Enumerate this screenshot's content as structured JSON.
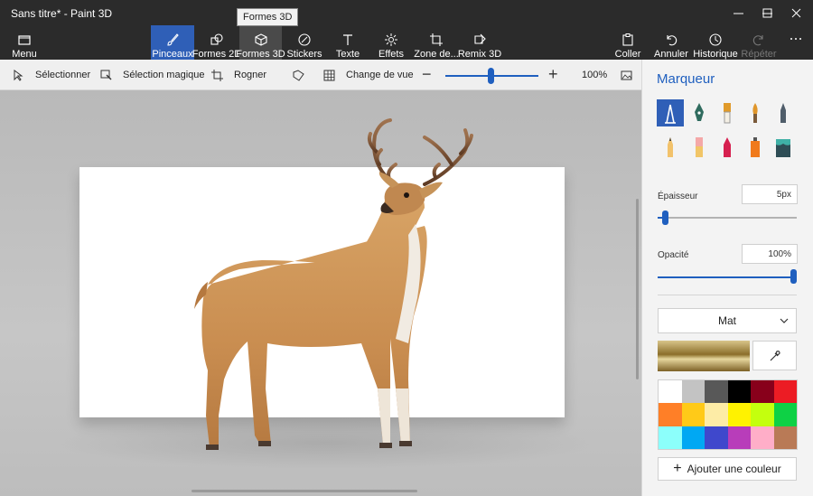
{
  "window": {
    "title": "Sans titre* - Paint 3D"
  },
  "ribbon": {
    "menu": "Menu",
    "brushes": "Pinceaux",
    "shapes2d": "Formes 2D",
    "shapes3d": "Formes 3D",
    "stickers": "Stickers",
    "text": "Texte",
    "effects": "Effets",
    "canvas": "Zone de...",
    "remix": "Remix 3D",
    "paste": "Coller",
    "undo": "Annuler",
    "history": "Historique",
    "redo": "Répéter",
    "tooltip": "Formes 3D"
  },
  "toolbar": {
    "select": "Sélectionner",
    "magic_select": "Sélection magique",
    "crop": "Rogner",
    "change_view": "Change de vue",
    "zoom_level": "100%",
    "zoom_value": 0.5
  },
  "panel": {
    "title": "Marqueur",
    "brushes": [
      "marker-icon",
      "calligraphy-pen-icon",
      "oil-brush-icon",
      "watercolor-icon",
      "pixel-pen-icon",
      "pencil-icon",
      "eraser-icon",
      "crayon-icon",
      "spray-can-icon",
      "fill-icon"
    ],
    "thickness_label": "Épaisseur",
    "thickness_value": "5px",
    "thickness_level": 0.05,
    "opacity_label": "Opacité",
    "opacity_value": "100%",
    "opacity_level": 1.0,
    "finish": "Mat",
    "add_color": "Ajouter une couleur",
    "palette": [
      "#ffffff",
      "#c3c3c3",
      "#585858",
      "#000000",
      "#88001b",
      "#ec1c24",
      "#ff7f27",
      "#ffca18",
      "#fdeca6",
      "#fff200",
      "#c4ff0e",
      "#0ed145",
      "#8cfffb",
      "#00a8f3",
      "#3f48cc",
      "#b83dba",
      "#ffaec8",
      "#b97a56"
    ]
  },
  "colors": {
    "accent": "#2f5fb7",
    "titlebar": "#2b2b2b"
  }
}
